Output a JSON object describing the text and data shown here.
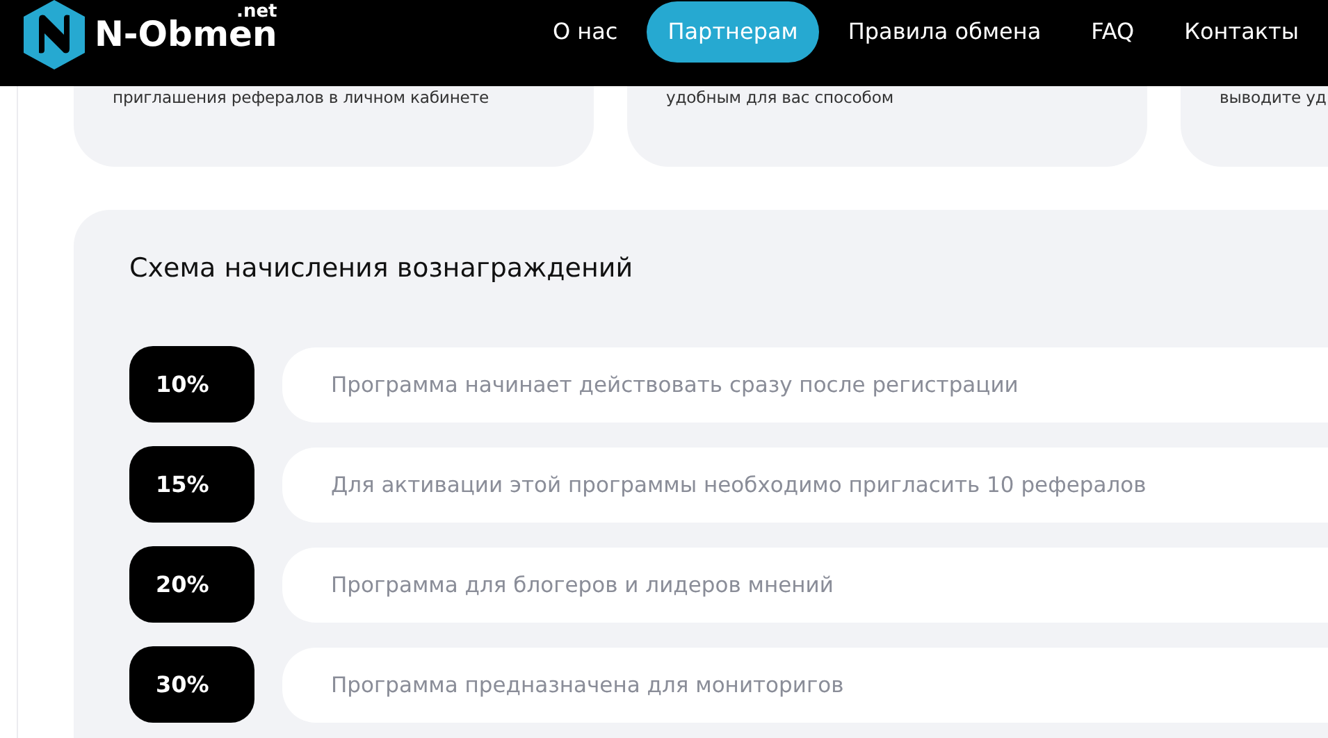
{
  "header": {
    "logo": {
      "name": "N-Obmen",
      "suffix": ".net"
    },
    "nav": [
      {
        "label": "О нас",
        "selected": false
      },
      {
        "label": "Партнерам",
        "selected": true
      },
      {
        "label": "Правила обмена",
        "selected": false
      },
      {
        "label": "FAQ",
        "selected": false
      },
      {
        "label": "Контакты",
        "selected": false
      }
    ]
  },
  "cards": [
    {
      "text": "приглашения рефералов в личном кабинете"
    },
    {
      "text": "удобным для вас способом"
    },
    {
      "text": "выводите уд"
    }
  ],
  "rewards": {
    "title": "Схема начисления вознаграждений",
    "rows": [
      {
        "percent": "10%",
        "description": "Программа начинает действовать сразу после регистрации"
      },
      {
        "percent": "15%",
        "description": "Для активации этой программы необходимо пригласить 10 рефералов"
      },
      {
        "percent": "20%",
        "description": "Программа для блогеров и лидеров мнений"
      },
      {
        "percent": "30%",
        "description": "Программа предназначена для мониторигов"
      }
    ]
  }
}
